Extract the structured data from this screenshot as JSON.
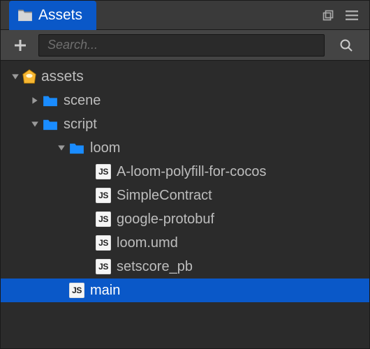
{
  "tab": {
    "label": "Assets"
  },
  "search": {
    "placeholder": "Search..."
  },
  "js_badge_text": "JS",
  "tree": {
    "root": {
      "label": "assets"
    },
    "scene": {
      "label": "scene"
    },
    "script": {
      "label": "script"
    },
    "loom": {
      "label": "loom"
    },
    "files": {
      "polyfill": {
        "label": "A-loom-polyfill-for-cocos"
      },
      "simple": {
        "label": "SimpleContract"
      },
      "protobuf": {
        "label": "google-protobuf"
      },
      "umd": {
        "label": "loom.umd"
      },
      "setscore": {
        "label": "setscore_pb"
      },
      "main": {
        "label": "main"
      }
    }
  }
}
